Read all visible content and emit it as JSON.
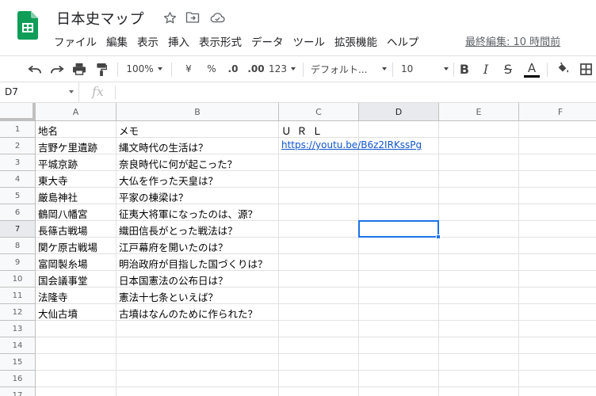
{
  "app": {
    "title": "日本史マップ",
    "menus": [
      "ファイル",
      "編集",
      "表示",
      "挿入",
      "表示形式",
      "データ",
      "ツール",
      "拡張機能",
      "ヘルプ"
    ],
    "last_edit": "最終編集: 10 時間前",
    "brand_color": "#0f9d58",
    "accent_color": "#1a73e8"
  },
  "toolbar": {
    "zoom": "100%",
    "currency": "¥",
    "percent": "%",
    "dec_decrease": ".0",
    "dec_increase": ".00",
    "more_formats": "123",
    "font": "デフォルト...",
    "font_size": "10",
    "bold": "B",
    "italic": "I",
    "strike": "S",
    "text_color": "A",
    "text_color_value": "#000000",
    "icons": [
      "undo-icon",
      "redo-icon",
      "print-icon",
      "paint-format-icon",
      "fill-color-icon",
      "borders-icon"
    ]
  },
  "formula_bar": {
    "name_box": "D7",
    "fx": "fx",
    "value": ""
  },
  "grid": {
    "columns": [
      "A",
      "B",
      "C",
      "D",
      "E",
      "F"
    ],
    "active_column": "D",
    "active_row": 7,
    "row_numbers": [
      "1",
      "2",
      "3",
      "4",
      "5",
      "6",
      "7",
      "8",
      "9",
      "10",
      "11",
      "12",
      "13",
      "14",
      "15",
      "16",
      "17"
    ],
    "rows": [
      [
        "地名",
        "メモ",
        "ＵＲＬ"
      ],
      [
        "吉野ケ里遺跡",
        "縄文時代の生活は？",
        "https://youtu.be/B6z2IRKssPg"
      ],
      [
        "平城京跡",
        "奈良時代に何が起こった？",
        ""
      ],
      [
        "東大寺",
        "大仏を作った天皇は？",
        ""
      ],
      [
        "厳島神社",
        "平家の棟梁は？",
        ""
      ],
      [
        "鶴岡八幡宮",
        "征夷大将軍になったのは、源？",
        ""
      ],
      [
        "長篠古戦場",
        "織田信長がとった戦法は？",
        ""
      ],
      [
        "関ケ原古戦場",
        "江戸幕府を開いたのは？",
        ""
      ],
      [
        "富岡製糸場",
        "明治政府が目指した国づくりは？",
        ""
      ],
      [
        "国会議事堂",
        "日本国憲法の公布日は？",
        ""
      ],
      [
        "法隆寺",
        "憲法十七条といえば？",
        ""
      ],
      [
        "大仙古墳",
        "古墳はなんのために作られた？",
        ""
      ]
    ]
  }
}
